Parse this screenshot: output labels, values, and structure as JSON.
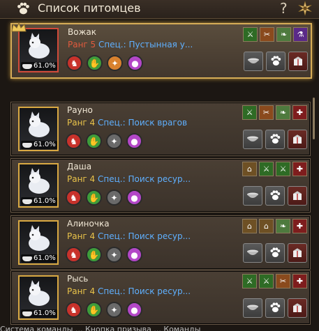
{
  "window": {
    "title": "Список питомцев",
    "help_label": "?"
  },
  "pets": [
    {
      "name": "Вожак",
      "rank": "Ранг 5",
      "spec": "Спец.: Пустынная у...",
      "feed": "61.0%",
      "leader": true,
      "talents": [
        "red",
        "green",
        "orange",
        "purple"
      ],
      "skills": [
        "green",
        "orange",
        "leaf",
        "purple"
      ]
    },
    {
      "name": "Рауно",
      "rank": "Ранг 4",
      "spec": "Спец.: Поиск врагов",
      "feed": "61.0%",
      "leader": false,
      "talents": [
        "red",
        "green",
        "gray",
        "purple"
      ],
      "skills": [
        "green",
        "orange",
        "leaf",
        "red"
      ]
    },
    {
      "name": "Даша",
      "rank": "Ранг 4",
      "spec": "Спец.: Поиск ресур...",
      "feed": "61.0%",
      "leader": false,
      "talents": [
        "red",
        "green",
        "gray",
        "purple"
      ],
      "skills": [
        "brown",
        "green",
        "green",
        "red"
      ]
    },
    {
      "name": "Алиночка",
      "rank": "Ранг 4",
      "spec": "Спец.: Поиск ресур...",
      "feed": "61.0%",
      "leader": false,
      "talents": [
        "red",
        "green",
        "gray",
        "purple"
      ],
      "skills": [
        "brown",
        "brown",
        "leaf",
        "red"
      ]
    },
    {
      "name": "Рысь",
      "rank": "Ранг 4",
      "spec": "Спец.: Поиск ресур...",
      "feed": "61.0%",
      "leader": false,
      "talents": [
        "red",
        "green",
        "gray",
        "purple"
      ],
      "skills": [
        "green",
        "green",
        "orange",
        "red"
      ]
    }
  ],
  "bottom": {
    "text": "Система команды ... Кнопка призыва ... Команды"
  }
}
